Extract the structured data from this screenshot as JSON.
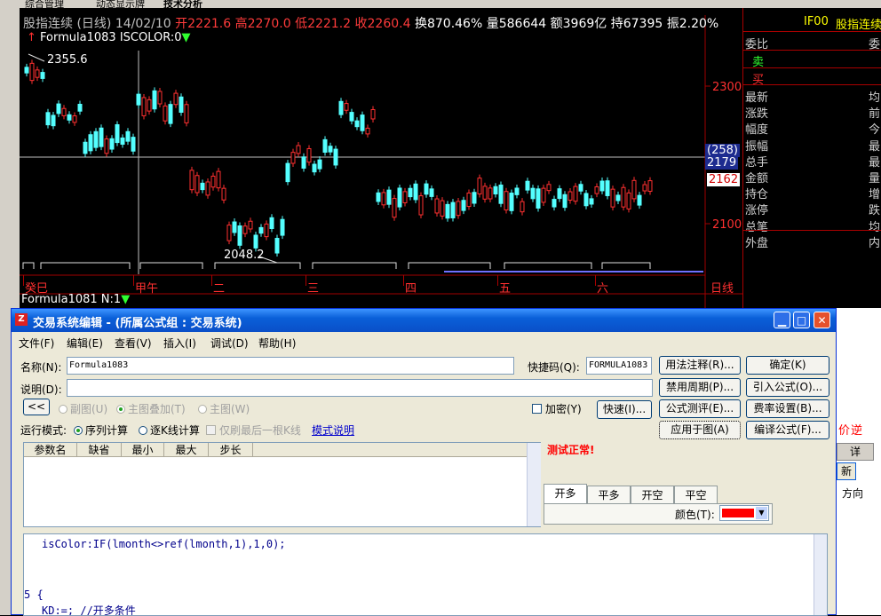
{
  "tabs": [
    "综合管理",
    "动态显示牌",
    "技术分析"
  ],
  "header": {
    "title": "股指连续 (日线) 14/02/10",
    "open_label": "开",
    "open": "2221.6",
    "high_label": "高",
    "high": "2270.0",
    "low_label": "低",
    "low": "2221.2",
    "close_label": "收",
    "close": "2260.4",
    "turnover_label": "换",
    "turnover": "870.46%",
    "volume_label": "量",
    "volume": "586644",
    "amount_label": "额",
    "amount": "3969亿",
    "position_label": "持",
    "position": "67395",
    "amplitude_label": "振",
    "amplitude": "2.20%"
  },
  "formula_line": {
    "name": "Formula1083",
    "param": "ISCOLOR:0"
  },
  "price_axis": {
    "p2300": "2300",
    "p2100": "2100",
    "tag_count": "(258)",
    "tag_price": "2179",
    "current": "2162"
  },
  "annotations": {
    "high": "2355.6",
    "low": "2048.2"
  },
  "time_axis": [
    "癸巳",
    "甲午",
    "二",
    "三",
    "四",
    "五",
    "六"
  ],
  "time_axis_right": "日线",
  "bottom_formula": {
    "name": "Formula1081",
    "param": "N:1"
  },
  "right_panel": {
    "code": "IF00",
    "name": "股指连续",
    "weibi": "委比",
    "weicha": "委",
    "sell": "卖",
    "buy": "买",
    "left_labels": [
      "最新",
      "涨跌",
      "幅度",
      "振幅",
      "总手",
      "金额",
      "持仓",
      "涨停",
      "总笔",
      "外盘"
    ],
    "right_labels": [
      "均",
      "前",
      "今",
      "最",
      "最",
      "量",
      "增",
      "跌",
      "均",
      "内"
    ]
  },
  "dialog": {
    "title": "交易系统编辑 - (所属公式组 : 交易系统)",
    "menu": [
      "文件(F)",
      "编辑(E)",
      "查看(V)",
      "插入(I)",
      "调试(D)",
      "帮助(H)"
    ],
    "name_label": "名称(N):",
    "name_value": "Formula1083",
    "shortcut_label": "快捷码(Q):",
    "shortcut_value": "FORMULA1083",
    "desc_label": "说明(D):",
    "desc_value": "",
    "btn_back": "<<",
    "opt_subchart": "副图(U)",
    "opt_overlay": "主图叠加(T)",
    "opt_main": "主图(W)",
    "encrypt": "加密(Y)",
    "quick": "快速(I)...",
    "run_mode_label": "运行模式:",
    "run_series": "序列计算",
    "run_each": "逐K线计算",
    "run_last": "仅刷最后一根K线",
    "mode_help": "模式说明",
    "buttons": {
      "usage": "用法注释(R)...",
      "confirm": "确定(K)",
      "forbid_period": "禁用周期(P)...",
      "import": "引入公式(O)...",
      "test": "公式测评(E)...",
      "fee": "费率设置(B)...",
      "apply": "应用于图(A)",
      "compile": "编译公式(F)..."
    },
    "status": "测试正常!",
    "param_headers": [
      "参数名",
      "缺省",
      "最小",
      "最大",
      "步长"
    ],
    "sig_tabs": [
      "开多",
      "平多",
      "开空",
      "平空"
    ],
    "color_label": "颜色(T):",
    "color_value": "#ff0000",
    "code_lines": [
      "isColor:IF(lmonth<>ref(lmonth,1),1,0);",
      "5  {",
      "KD:=;         //开多条件"
    ]
  },
  "right_strip": {
    "label_price": "价",
    "label_reverse": "逆",
    "label_detail": "详",
    "label_new": "新",
    "label_dir": "方向"
  }
}
